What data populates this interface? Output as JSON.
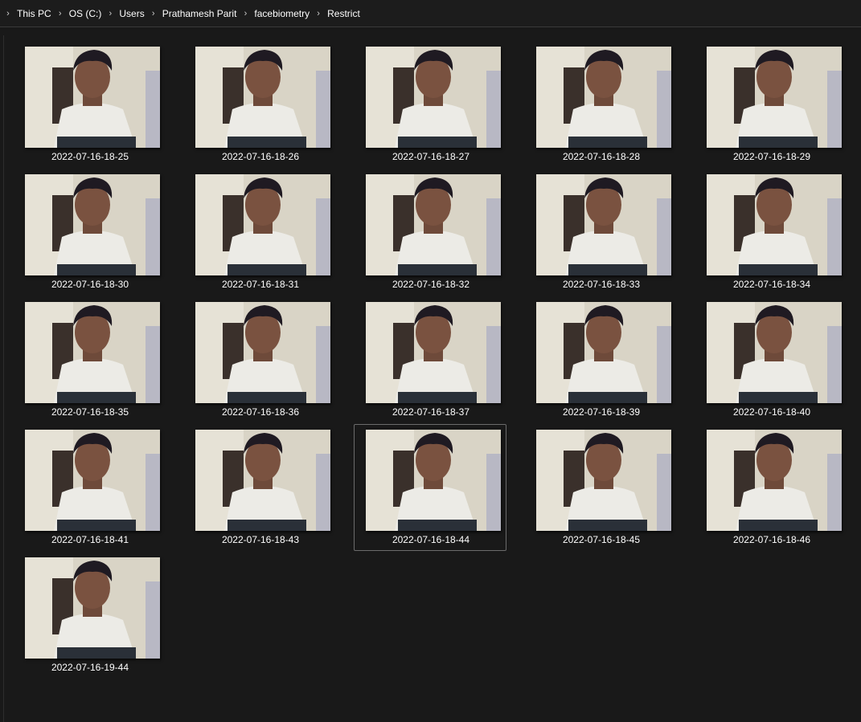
{
  "breadcrumb": [
    "This PC",
    "OS (C:)",
    "Users",
    "Prathamesh Parit",
    "facebiometry",
    "Restrict"
  ],
  "files": [
    {
      "name": "2022-07-16-18-25"
    },
    {
      "name": "2022-07-16-18-26"
    },
    {
      "name": "2022-07-16-18-27"
    },
    {
      "name": "2022-07-16-18-28"
    },
    {
      "name": "2022-07-16-18-29"
    },
    {
      "name": "2022-07-16-18-30"
    },
    {
      "name": "2022-07-16-18-31"
    },
    {
      "name": "2022-07-16-18-32"
    },
    {
      "name": "2022-07-16-18-33"
    },
    {
      "name": "2022-07-16-18-34"
    },
    {
      "name": "2022-07-16-18-35"
    },
    {
      "name": "2022-07-16-18-36"
    },
    {
      "name": "2022-07-16-18-37"
    },
    {
      "name": "2022-07-16-18-39"
    },
    {
      "name": "2022-07-16-18-40"
    },
    {
      "name": "2022-07-16-18-41"
    },
    {
      "name": "2022-07-16-18-43"
    },
    {
      "name": "2022-07-16-18-44",
      "selected": true
    },
    {
      "name": "2022-07-16-18-45"
    },
    {
      "name": "2022-07-16-18-46"
    },
    {
      "name": "2022-07-16-19-44"
    }
  ],
  "colors": {
    "background": "#191919",
    "selection_border": "#6b6b6b",
    "text": "#ffffff"
  },
  "icons": {
    "breadcrumb_separator": "chevron-right-icon"
  }
}
